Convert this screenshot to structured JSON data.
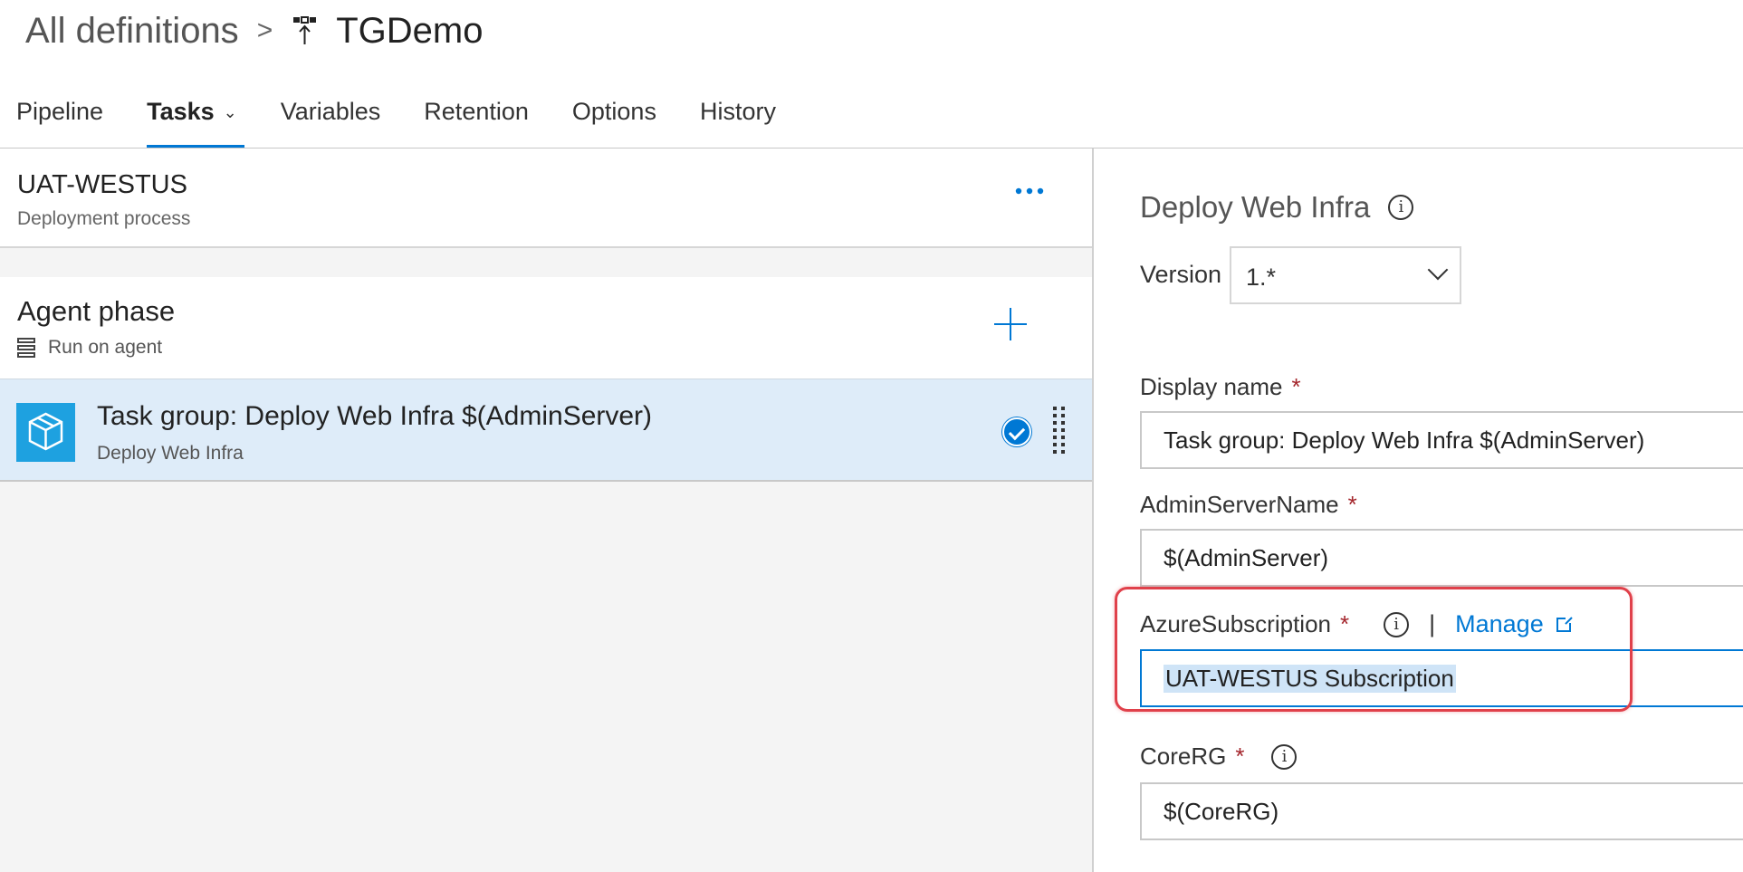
{
  "breadcrumb": {
    "root": "All definitions",
    "separator": ">",
    "definition": "TGDemo"
  },
  "tabs": [
    {
      "label": "Pipeline",
      "active": false
    },
    {
      "label": "Tasks",
      "active": true
    },
    {
      "label": "Variables",
      "active": false
    },
    {
      "label": "Retention",
      "active": false
    },
    {
      "label": "Options",
      "active": false
    },
    {
      "label": "History",
      "active": false
    }
  ],
  "stage": {
    "name": "UAT-WESTUS",
    "subtitle": "Deployment process",
    "more_icon": "ellipsis-icon"
  },
  "phase": {
    "name": "Agent phase",
    "subtitle": "Run on agent",
    "add_icon": "plus-icon"
  },
  "task": {
    "title": "Task group: Deploy Web Infra $(AdminServer)",
    "subtitle": "Deploy Web Infra",
    "enabled": true,
    "icon": "task-group-icon"
  },
  "details": {
    "title": "Deploy Web Infra",
    "version_label": "Version",
    "version_value": "1.*",
    "fields": {
      "display_name": {
        "label": "Display name",
        "required_mark": "*",
        "value": "Task group: Deploy Web Infra $(AdminServer)"
      },
      "admin_server": {
        "label": "AdminServerName",
        "required_mark": "*",
        "value": "$(AdminServer)"
      },
      "azure_subscription": {
        "label": "AzureSubscription",
        "required_mark": "*",
        "separator": "|",
        "manage_label": "Manage",
        "value": "UAT-WESTUS Subscription"
      },
      "core_rg": {
        "label": "CoreRG",
        "required_mark": "*",
        "value": "$(CoreRG)"
      }
    },
    "info_glyph": "i"
  },
  "colors": {
    "accent": "#0078d4",
    "selected_row": "#deecf9",
    "required": "#a4262c",
    "highlight": "#e0404a",
    "task_icon_bg": "#1ea1e0"
  }
}
